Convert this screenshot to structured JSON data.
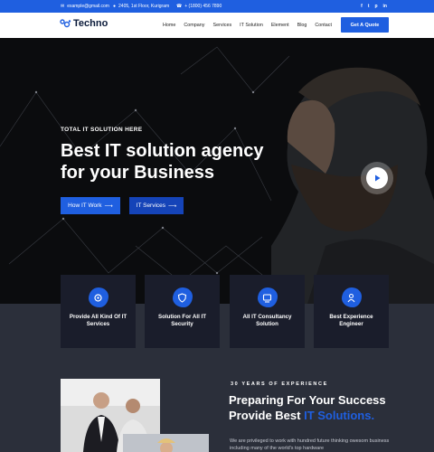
{
  "topbar": {
    "email": "example@gmail.com",
    "address": "2405, 1st Floor, Kurigram",
    "phone": "+ (1800) 456 7890",
    "social": [
      "f",
      "t",
      "p",
      "in"
    ]
  },
  "nav": {
    "logo": "Techno",
    "items": [
      "Home",
      "Company",
      "Services",
      "IT Solution",
      "Element",
      "Blog",
      "Contact"
    ],
    "cta": "Get A Quote"
  },
  "hero": {
    "tagline": "TOTAL IT SOLUTION HERE",
    "title_line1": "Best IT solution agency",
    "title_line2": "for your Business",
    "btn_primary": "How IT Work",
    "btn_secondary": "IT Services"
  },
  "features": [
    {
      "label": "Provide All Kind Of IT Services",
      "icon": "services-icon"
    },
    {
      "label": "Solution For All IT Security",
      "icon": "security-icon"
    },
    {
      "label": "All IT Consultancy Solution",
      "icon": "consultancy-icon"
    },
    {
      "label": "Best Experience Engineer",
      "icon": "engineer-icon"
    }
  ],
  "about": {
    "kicker": "30 YEARS OF EXPERIENCE",
    "title_line1": "Preparing For Your Success",
    "title_line2_plain": "Provide Best ",
    "title_line2_accent": "IT Solutions.",
    "body": "We are privileged to work with hundred future thinking owesom business including many of the world's top hardware"
  },
  "colors": {
    "accent": "#1f5fe0",
    "dark": "#0b0c0e",
    "card": "#1a1d2b",
    "lower": "#2b2f3a"
  }
}
